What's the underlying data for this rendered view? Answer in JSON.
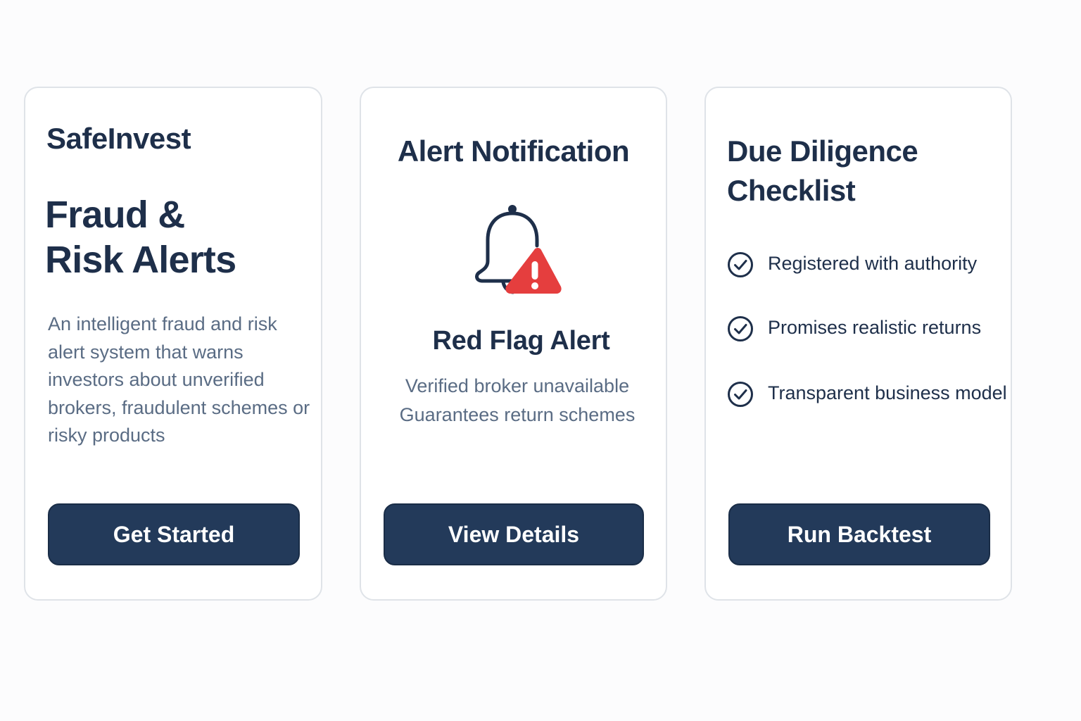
{
  "brand_card": {
    "brand": "SafeInvest",
    "title_line1": "Fraud &",
    "title_line2": "Risk Alerts",
    "description": "An intelligent fraud and risk alert system that warns investors about unverified brokers, fraudulent schemes or risky products",
    "button_label": "Get Started"
  },
  "alert_card": {
    "title": "Alert Notification",
    "icon": "bell-warning-icon",
    "alert_title": "Red Flag Alert",
    "alert_lines": [
      "Verified broker unavailable",
      "Guarantees return schemes"
    ],
    "button_label": "View Details"
  },
  "checklist_card": {
    "title": "Due Diligence Checklist",
    "items": [
      {
        "label": "Registered with authority",
        "icon": "check-circle-icon"
      },
      {
        "label": "Promises realistic returns",
        "icon": "check-circle-icon"
      },
      {
        "label": "Transparent business model",
        "icon": "check-circle-icon"
      }
    ],
    "button_label": "Run Backtest"
  },
  "colors": {
    "navy": "#1e2f4a",
    "button": "#233a5a",
    "muted_text": "#5a6c84",
    "warning_red": "#e53e3e",
    "card_border": "#dfe3e8"
  }
}
